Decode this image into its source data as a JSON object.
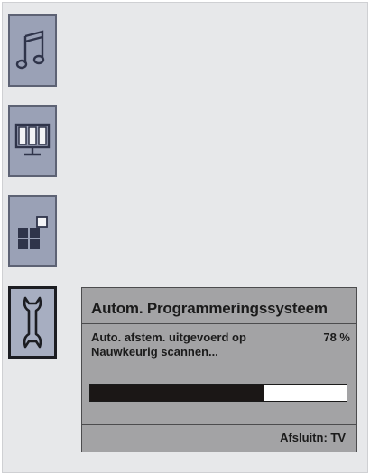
{
  "menu": {
    "items": [
      {
        "icon": "music-note-icon",
        "selected": false
      },
      {
        "icon": "picture-monitor-icon",
        "selected": false
      },
      {
        "icon": "features-blocks-icon",
        "selected": false
      },
      {
        "icon": "wrench-setup-icon",
        "selected": true
      }
    ]
  },
  "dialog": {
    "title": "Autom. Programmeringssysteem",
    "status_line": "Auto. afstem. uitgevoerd op",
    "percent_label": "78 %",
    "scanning_line": "Nauwkeurig scannen...",
    "progress_fraction": 0.68,
    "exit_hint": "Afsluitn: TV"
  },
  "colors": {
    "icon_tile": "#9aa1b6",
    "icon_glyph": "#2f344a",
    "dialog_bg": "#a3a3a5",
    "progress_fill": "#1b1716"
  }
}
